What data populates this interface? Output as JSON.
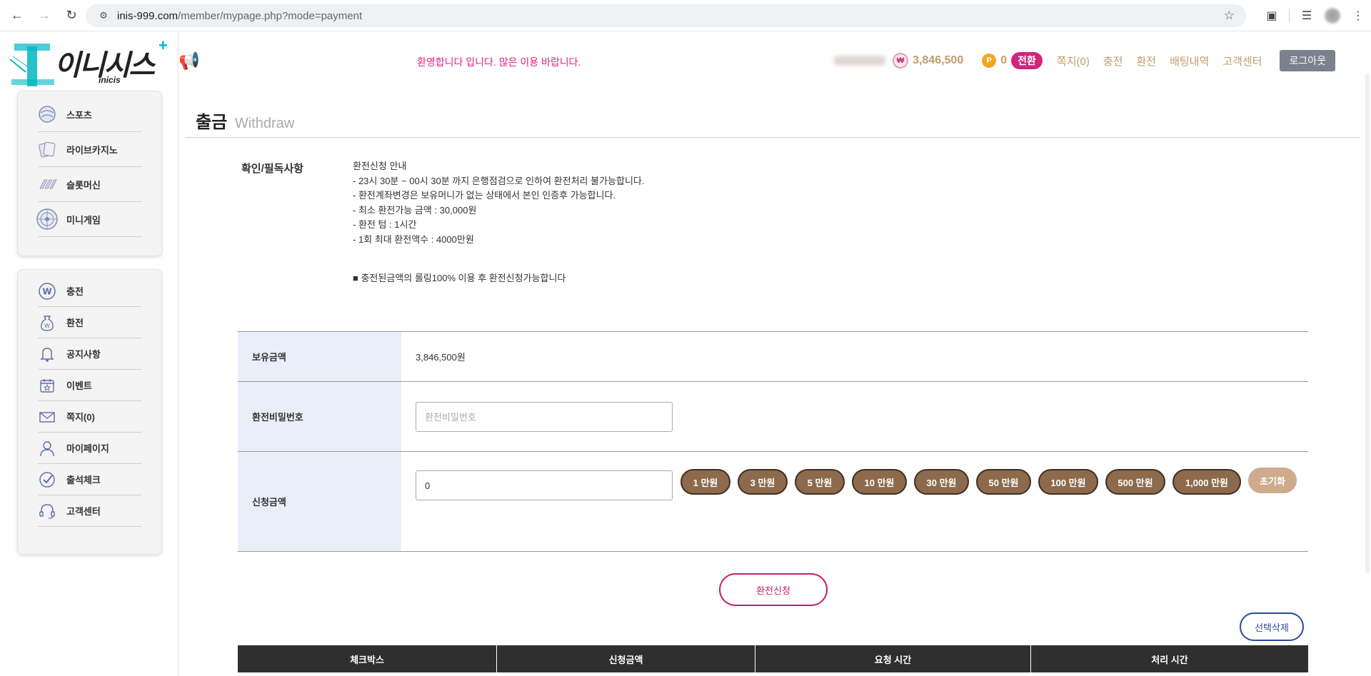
{
  "browser": {
    "url_host": "inis-999.com",
    "url_path": "/member/mypage.php?mode=payment"
  },
  "logo": {
    "text": "이니시스",
    "sub": "inicis"
  },
  "header": {
    "welcome": "환영합니다 입니다. 많은 이용 바랍니다.",
    "won_symbol": "₩",
    "money": "3,846,500",
    "point_symbol": "P",
    "point": "0",
    "convert_label": "전환",
    "nav": [
      "쪽지(0)",
      "충전",
      "환전",
      "배팅내역",
      "고객센터"
    ],
    "logout_label": "로그아웃"
  },
  "sidebar": {
    "games": [
      {
        "label": "스포츠",
        "icon": "sports-ball-icon"
      },
      {
        "label": "라이브카지노",
        "icon": "cards-icon"
      },
      {
        "label": "슬롯머신",
        "icon": "slot-machine-icon"
      },
      {
        "label": "미니게임",
        "icon": "roulette-icon"
      }
    ],
    "menu": [
      {
        "label": "충전",
        "icon": "won-coin-icon"
      },
      {
        "label": "환전",
        "icon": "money-bag-icon"
      },
      {
        "label": "공지사항",
        "icon": "bell-icon"
      },
      {
        "label": "이벤트",
        "icon": "calendar-star-icon"
      },
      {
        "label": "쪽지(0)",
        "icon": "envelope-icon"
      },
      {
        "label": "마이페이지",
        "icon": "user-icon"
      },
      {
        "label": "출석체크",
        "icon": "check-circle-icon"
      },
      {
        "label": "고객센터",
        "icon": "headset-icon"
      }
    ]
  },
  "main": {
    "title": "출금",
    "title_sub": "Withdraw",
    "notice_label": "확인/필독사항",
    "notice_lines": [
      "환전신청 안내",
      "- 23시 30분 ~ 00시 30분 까지 은행점검으로 인하여 환전처리 불가능합니다.",
      "- 환전계좌변경은 보유머니가 없는 상태에서 본인 인증후 가능합니다.",
      "- 최소 환전가능 금액 : 30,000원",
      "- 환전 텀 : 1시간",
      "- 1회 최대 환전액수 : 4000만원"
    ],
    "notice_extra": "■ 충전된금액의 롤링100% 이용 후 환전신청가능합니다",
    "form": {
      "balance_label": "보유금액",
      "balance_value": "3,846,500원",
      "password_label": "환전비밀번호",
      "password_placeholder": "환전비밀번호",
      "amount_label": "신청금액",
      "amount_value": "0",
      "amount_buttons": [
        "1 만원",
        "3 만원",
        "5 만원",
        "10 만원",
        "30 만원",
        "50 만원",
        "100 만원",
        "500 만원",
        "1,000 만원"
      ],
      "reset_label": "초기화"
    },
    "submit_label": "환전신청",
    "delete_label": "선택삭제",
    "list_headers": [
      "체크박스",
      "신청금액",
      "요청 시간",
      "처리 시간"
    ]
  }
}
